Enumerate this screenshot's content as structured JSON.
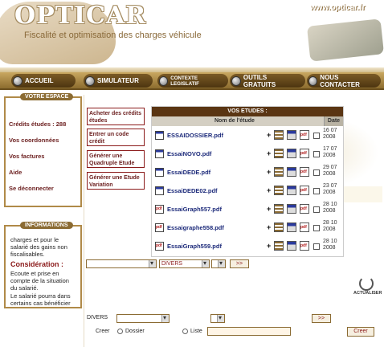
{
  "header": {
    "logo": "OPTICAR",
    "tagline": "Fiscalité et optimisation des charges véhicule",
    "site_url": "www.opticar.fr"
  },
  "nav": {
    "items": [
      {
        "label": "ACCUEIL"
      },
      {
        "label": "SIMULATEUR"
      },
      {
        "label": "CONTEXTE LEGISLATIF"
      },
      {
        "label": "OUTILS GRATUITS"
      },
      {
        "label": "NOUS CONTACTER"
      }
    ]
  },
  "sidebar": {
    "title": "VOTRE ESPACE",
    "links": [
      {
        "label": "Crédits études : 288"
      },
      {
        "label": "Vos coordonnées"
      },
      {
        "label": "Vos factures"
      },
      {
        "label": "Aide"
      },
      {
        "label": "Se déconnecter"
      }
    ]
  },
  "info": {
    "title": "INFORMATIONS",
    "line1": "charges et pour le",
    "line2": "salarié des gains non",
    "line3": "fiscalisables.",
    "heading": "Considération :",
    "line4": "Ecoute et prise en",
    "line5": "compte de la situation",
    "line6": "du salarié.",
    "line7": "Le salarié pourra dans",
    "line8": "certains cas bénéficier"
  },
  "actions": [
    {
      "label": "Acheter des crédits études"
    },
    {
      "label": "Entrer un code crédit"
    },
    {
      "label": "Générer une Quadruple Etude"
    },
    {
      "label": "Générer une Etude Variation"
    }
  ],
  "studies": {
    "title": "VOS ETUDES :",
    "col_name": "Nom de l'étude",
    "col_date": "Date",
    "plus": "+",
    "rows": [
      {
        "name": "ESSAIDOSSIER.pdf",
        "icon": "doc",
        "d1": "16 07",
        "d2": "2008"
      },
      {
        "name": "EssaiNOVO.pdf",
        "icon": "doc",
        "d1": "17 07",
        "d2": "2008"
      },
      {
        "name": "EssaiDEDE.pdf",
        "icon": "doc",
        "d1": "29 07",
        "d2": "2008"
      },
      {
        "name": "EssaiDEDE02.pdf",
        "icon": "doc",
        "d1": "23 07",
        "d2": "2008"
      },
      {
        "name": "EssaiGraph557.pdf",
        "icon": "pdf",
        "d1": "28 10",
        "d2": "2008"
      },
      {
        "name": "Essaigraphe558.pdf",
        "icon": "pdf",
        "d1": "28 10",
        "d2": "2008"
      },
      {
        "name": "EssaiGraph559.pdf",
        "icon": "pdf",
        "d1": "28 10",
        "d2": "2008"
      }
    ]
  },
  "filters": {
    "divers_value": "DIVERS",
    "go_label": ">>"
  },
  "bottom": {
    "divers_label": "DIVERS",
    "go_label": ">>",
    "creer_label": "Creer",
    "dossier_label": "Dossier",
    "liste_label": "Liste",
    "creer_button": "Creer"
  },
  "refresh_label": "ACTUALISER"
}
